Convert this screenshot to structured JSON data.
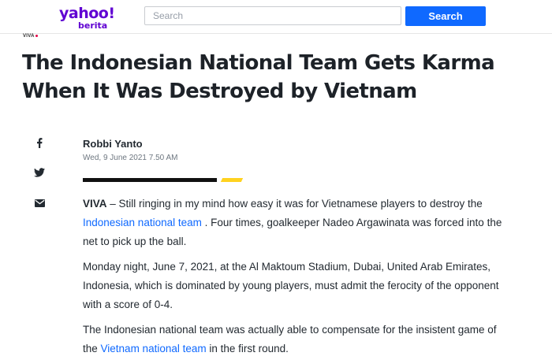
{
  "header": {
    "logo_main": "yahoo!",
    "logo_sub": "berita",
    "search_placeholder": "Search",
    "search_button": "Search",
    "brand_color": "#6001d2",
    "accent_color": "#0f69ff"
  },
  "provider": {
    "logo_text": "VIVA"
  },
  "article": {
    "title": "The Indonesian National Team Gets Karma When It Was Destroyed by Vietnam",
    "author": "Robbi Yanto",
    "date": "Wed, 9 June 2021 7.50 AM",
    "share_icons": [
      "facebook-icon",
      "twitter-icon",
      "mail-icon"
    ],
    "paragraph1": {
      "source": "VIVA",
      "text_a": " – Still ringing in my mind how easy it was for Vietnamese players to destroy the ",
      "link": "Indonesian national team",
      "text_b": " . Four times, goalkeeper Nadeo Argawinata was forced into the net to pick up the ball."
    },
    "paragraph2": "Monday night, June 7, 2021, at the Al Maktoum Stadium, Dubai, United Arab Emirates, Indonesia, which is dominated by young players, must admit the ferocity of the opponent with a score of 0-4.",
    "paragraph3": {
      "text_a": "The Indonesian national team was actually able to compensate for the insistent game of the ",
      "link": "Vietnam national team",
      "text_b": " in the first round."
    }
  }
}
